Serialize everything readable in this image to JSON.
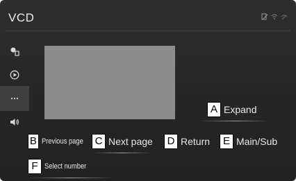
{
  "header": {
    "title": "VCD"
  },
  "controls": {
    "expand": {
      "key": "A",
      "label": "Expand"
    },
    "previous_page": {
      "key": "B",
      "label": "Previous page"
    },
    "next_page": {
      "key": "C",
      "label": "Next page"
    },
    "return": {
      "key": "D",
      "label": "Return"
    },
    "main_sub": {
      "key": "E",
      "label": "Main/Sub"
    },
    "select_number": {
      "key": "F",
      "label": "Select number"
    }
  },
  "sidebar": {
    "items": [
      {
        "icon": "source-icon"
      },
      {
        "icon": "play-icon"
      },
      {
        "icon": "more-icon"
      },
      {
        "icon": "volume-icon"
      }
    ]
  },
  "colors": {
    "background": "#2a2a2a",
    "video_area": "#8c8c8c",
    "text": "#e8e8e8"
  }
}
